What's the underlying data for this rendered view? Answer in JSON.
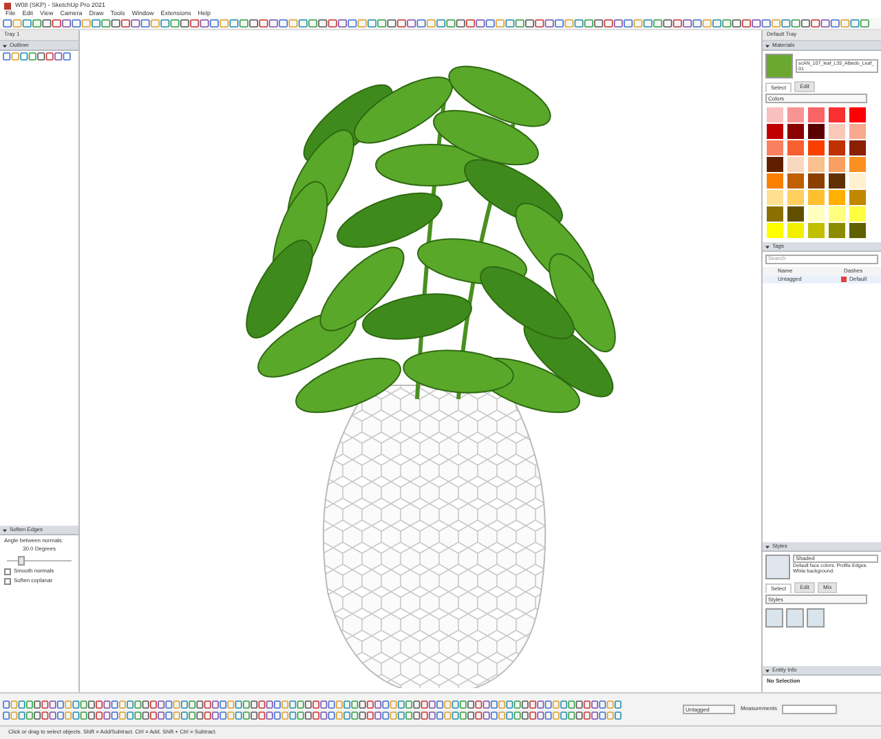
{
  "window": {
    "title": "W08 (SKP) - SketchUp Pro 2021"
  },
  "menu": [
    "File",
    "Edit",
    "View",
    "Camera",
    "Draw",
    "Tools",
    "Window",
    "Extensions",
    "Help"
  ],
  "left_tray": {
    "title": "Tray 1",
    "outliner": {
      "title": "Outliner"
    },
    "soften_edges": {
      "title": "Soften Edges",
      "angle_label": "Angle between normals:",
      "angle_value": "30.0  Degrees",
      "level": 0.17,
      "options": [
        {
          "label": "Smooth normals",
          "checked": false
        },
        {
          "label": "Soften coplanar",
          "checked": false
        }
      ]
    }
  },
  "right_tray": {
    "title": "Default Tray",
    "materials": {
      "title": "Materials",
      "name": "scAN_107_leaf_L35_Albedo_Leaf_01",
      "tabs": [
        {
          "label": "Select",
          "selected": true
        },
        {
          "label": "Edit",
          "selected": false
        }
      ],
      "library": "Colors",
      "swatches": [
        {
          "color": "#f9c0c0"
        },
        {
          "color": "#f99494"
        },
        {
          "color": "#f96464"
        },
        {
          "color": "#f93030"
        },
        {
          "color": "#ff0000"
        },
        {
          "color": "#c00000"
        },
        {
          "color": "#8b0000"
        },
        {
          "color": "#5a0000"
        },
        {
          "color": "#f9c8b8"
        },
        {
          "color": "#f9a890"
        },
        {
          "color": "#f98060"
        },
        {
          "color": "#f96030"
        },
        {
          "color": "#f94000"
        },
        {
          "color": "#c03000"
        },
        {
          "color": "#8b2000"
        },
        {
          "color": "#602000"
        },
        {
          "color": "#f9d8c0"
        },
        {
          "color": "#f9c090"
        },
        {
          "color": "#f9a060"
        },
        {
          "color": "#f99020"
        },
        {
          "color": "#f98000"
        },
        {
          "color": "#c06000"
        },
        {
          "color": "#8b4000"
        },
        {
          "color": "#603000"
        },
        {
          "color": "#fff0d0"
        },
        {
          "color": "#ffe090"
        },
        {
          "color": "#ffd060"
        },
        {
          "color": "#ffc030"
        },
        {
          "color": "#ffb000"
        },
        {
          "color": "#c08800"
        },
        {
          "color": "#8b7000"
        },
        {
          "color": "#605000"
        },
        {
          "color": "#ffffc0"
        },
        {
          "color": "#ffff80"
        },
        {
          "color": "#ffff40"
        },
        {
          "color": "#ffff00"
        },
        {
          "color": "#f0f000"
        },
        {
          "color": "#c0c000"
        },
        {
          "color": "#8b8b00"
        },
        {
          "color": "#606000"
        }
      ]
    },
    "tags": {
      "title": "Tags",
      "search_placeholder": "Search",
      "columns": [
        "Name",
        "Dashes"
      ],
      "rows": [
        {
          "name": "Untagged",
          "color": "#e04040",
          "dashes": "Default",
          "selected": true
        }
      ]
    },
    "styles": {
      "title": "Styles",
      "name": "Shaded",
      "description": "Default face colors. Profile Edges. White background.",
      "tabs": [
        {
          "label": "Select",
          "selected": true
        },
        {
          "label": "Edit",
          "selected": false
        },
        {
          "label": "Mix",
          "selected": false
        }
      ],
      "library": "Styles"
    },
    "entity_info": {
      "title": "Entity Info",
      "text": "No Selection"
    }
  },
  "bottom_bar": {
    "tag": "Untagged",
    "measurements_label": "Measurements"
  },
  "status_bar": {
    "text": "Click or drag to select objects. Shift = Add/Subtract. Ctrl = Add. Shift + Ctrl = Subtract."
  }
}
